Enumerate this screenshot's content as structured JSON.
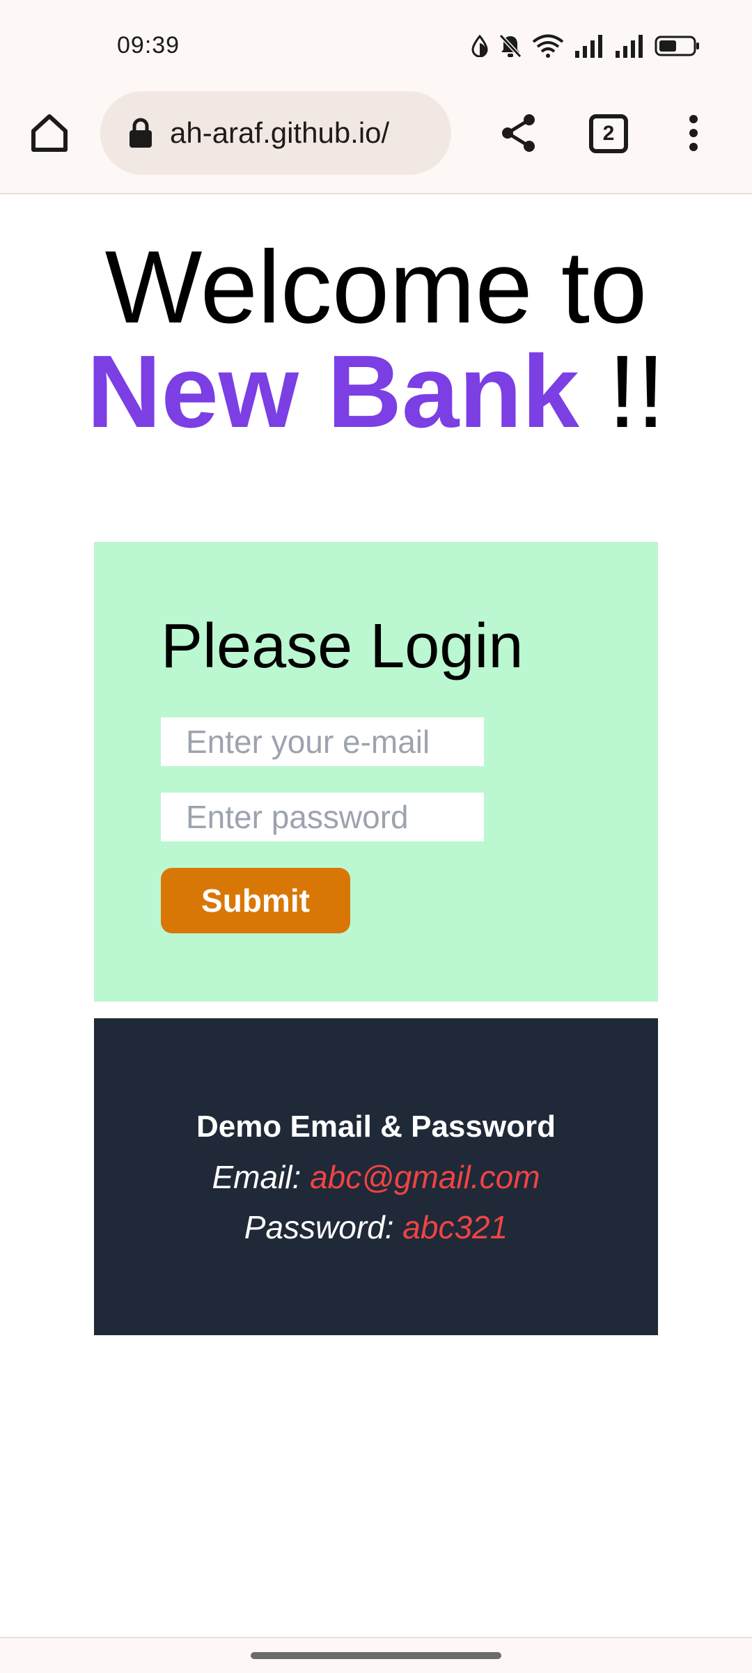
{
  "status_bar": {
    "time": "09:39",
    "icons": [
      "data-saver-icon",
      "bell-muted-icon",
      "wifi-icon",
      "signal-icon",
      "signal-icon",
      "battery-icon"
    ]
  },
  "browser": {
    "url": "ah-araf.github.io/",
    "tab_count": "2",
    "icons": [
      "home-icon",
      "lock-icon",
      "share-icon",
      "more-vert-icon"
    ]
  },
  "headline": {
    "line1": "Welcome to",
    "brand": "New Bank",
    "suffix": " !!"
  },
  "login": {
    "title": "Please Login",
    "email_placeholder": "Enter your e-mail",
    "email_value": "",
    "password_placeholder": "Enter password",
    "password_value": "",
    "submit_label": "Submit"
  },
  "demo": {
    "title": "Demo Email & Password",
    "email_label": "Email:",
    "email_value": "abc@gmail.com",
    "password_label": "Password:",
    "password_value": "abc321"
  },
  "colors": {
    "brand": "#7b3fe4",
    "login_bg": "#bbf7d0",
    "submit_bg": "#d97706",
    "demo_bg": "#1f2937",
    "demo_accent": "#ef4444"
  }
}
